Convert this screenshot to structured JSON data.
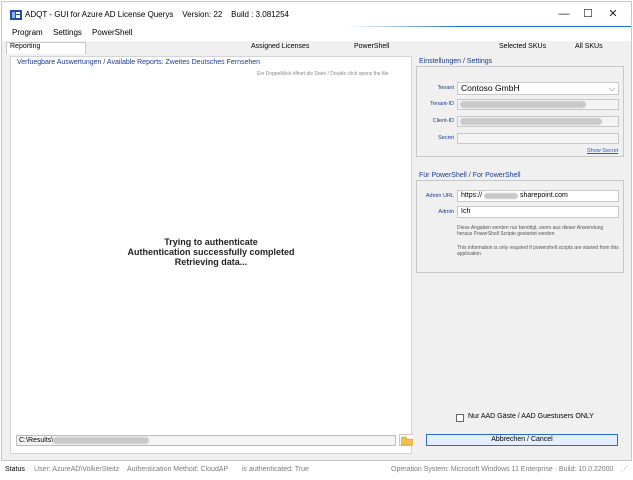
{
  "window": {
    "title": "ADQT - GUI for Azure AD License Querys    Version: 22    Build : 3.081254",
    "minimize": "—",
    "maximize": "☐",
    "close": "✕"
  },
  "menu": [
    "Program",
    "Settings",
    "PowerShell"
  ],
  "tabs": {
    "reporting": "Reporting",
    "assigned_licenses": "Assigned Licenses",
    "powershell": "PowerShell",
    "selected_skus": "Selected SKUs",
    "all_skus": "All SKUs"
  },
  "left": {
    "group_title": "Verfuegbare Auswertungen / Available Reports: Zweites Deutsches Fernsehen",
    "hint": "Ein Doppelklick öffnet die Datei / Double click opens the file",
    "messages": [
      "Trying to authenticate",
      "Authentication successfully completed",
      "Retrieving data..."
    ],
    "path_value": "C:\\Results\\"
  },
  "settings": {
    "title": "Einstellungen / Settings",
    "tenant_label": "Tenant",
    "tenant_value": "Contoso GmbH",
    "tenant_id_label": "Tenant-ID",
    "client_id_label": "Client-ID",
    "secret_label": "Secret",
    "show_secret": "Show Secret"
  },
  "powershell": {
    "title": "Für PowerShell / For PowerShell",
    "admin_url_label": "Admin URL",
    "admin_url_prefix": "https://",
    "admin_url_suffix": "sharepoint.com",
    "admin_label": "Admin",
    "admin_value": "Ich",
    "info_de": "Diese Angaben werden nur benötigt, wenn aus dieser Anwendung heraus PowerShell Scripte gestartet werden",
    "info_en": "This information is only required if powershell scripts are started from this application"
  },
  "guest_only_label": "Nur AAD Gäste / AAD Guestusers ONLY",
  "guest_only_checked": false,
  "cancel_label": "Abbrechen / Cancel",
  "status": {
    "label": "Status",
    "user": "User: AzureAD\\VolkerSteitz",
    "auth_method": "Authentication Method: CloudAP",
    "authenticated": "is authenticated: True",
    "os": "Operation System: Microsoft Windows 11 Enterprise · Build: 10.0.22000"
  },
  "colors": {
    "accent": "#1e6ed2",
    "label_blue": "#1a3b8c",
    "link": "#1a5fc8"
  }
}
